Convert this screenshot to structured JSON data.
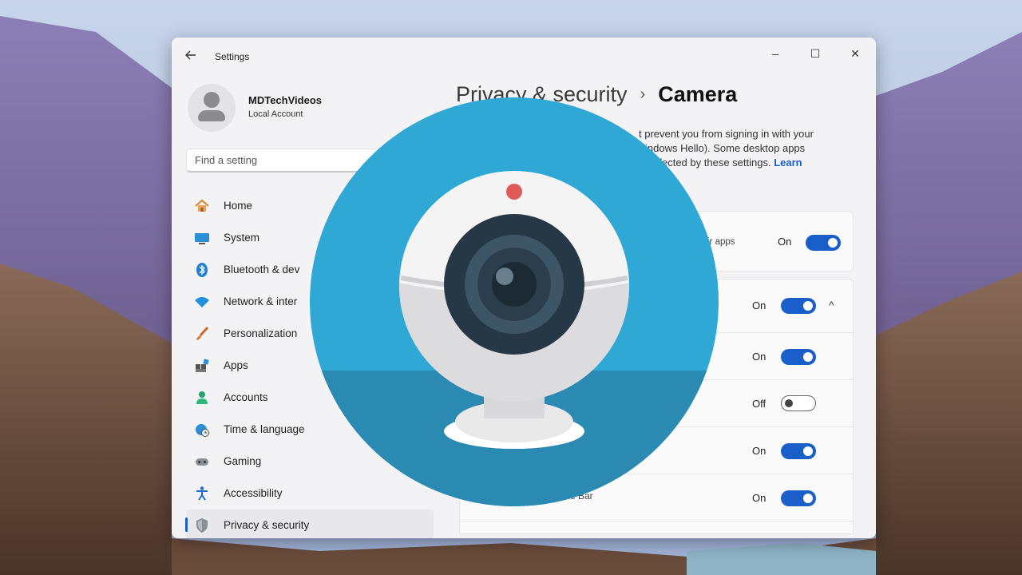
{
  "window": {
    "title": "Settings",
    "back_icon": "back-arrow-icon",
    "controls": {
      "minimize": "–",
      "maximize": "☐",
      "close": "✕"
    }
  },
  "account": {
    "name": "MDTechVideos",
    "type": "Local Account"
  },
  "search": {
    "placeholder": "Find a setting"
  },
  "nav": [
    {
      "label": "Home",
      "icon": "home-icon"
    },
    {
      "label": "System",
      "icon": "monitor-icon"
    },
    {
      "label": "Bluetooth & dev",
      "icon": "bluetooth-icon"
    },
    {
      "label": "Network & inter",
      "icon": "wifi-icon"
    },
    {
      "label": "Personalization",
      "icon": "paintbrush-icon"
    },
    {
      "label": "Apps",
      "icon": "apps-icon"
    },
    {
      "label": "Accounts",
      "icon": "person-icon"
    },
    {
      "label": "Time & language",
      "icon": "globe-clock-icon"
    },
    {
      "label": "Gaming",
      "icon": "gamepad-icon"
    },
    {
      "label": "Accessibility",
      "icon": "accessibility-icon"
    },
    {
      "label": "Privacy & security",
      "icon": "shield-icon",
      "selected": true
    }
  ],
  "header": {
    "parent": "Privacy & security",
    "separator": "›",
    "current": "Camera"
  },
  "description": {
    "line1": "t prevent you from signing in with your",
    "line2": "indows Hello). Some desktop apps",
    "line3": "ffected by these settings.",
    "link": "Learn"
  },
  "settings": {
    "top_label": "ir apps",
    "top_state": "On",
    "group_state": "On",
    "group_chevron": "^",
    "rows": [
      {
        "label": "",
        "state": "On",
        "on": true
      },
      {
        "label": "",
        "state": "Off",
        "on": false
      },
      {
        "label": "",
        "state": "On",
        "on": true
      },
      {
        "label": "me Bar",
        "state": "On",
        "on": true
      }
    ]
  },
  "colors": {
    "accent": "#1a5fc9",
    "logo_circle": "#2fa8d5",
    "logo_circle_dark": "#2a8ab2",
    "lens_dark": "#263845",
    "indicator_red": "#e05a5a"
  },
  "overlay": {
    "icon": "webcam-logo-icon"
  }
}
